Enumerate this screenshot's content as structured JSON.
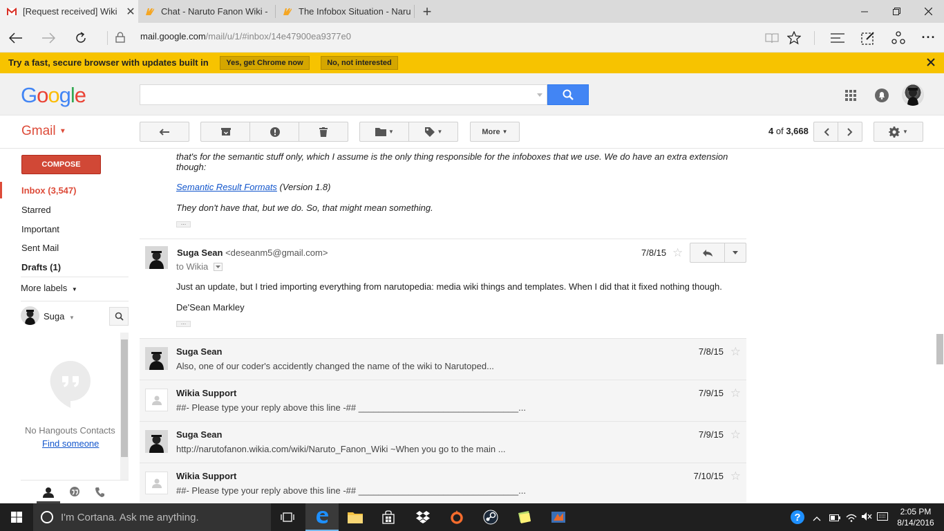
{
  "browser": {
    "tabs": [
      {
        "title": "[Request received] Wiki"
      },
      {
        "title": "Chat - Naruto Fanon Wiki -"
      },
      {
        "title": "The Infobox Situation - Naru"
      }
    ],
    "url_host": "mail.google.com",
    "url_path": "/mail/u/1/#inbox/14e47900ea9377e0"
  },
  "infobar": {
    "message": "Try a fast, secure browser with updates built in",
    "yes_label": "Yes, get Chrome now",
    "no_label": "No, not interested"
  },
  "header": {
    "logo": "Google"
  },
  "toolbar": {
    "app_label": "Gmail",
    "more_label": "More",
    "pagination_current": "4",
    "pagination_of": "of",
    "pagination_total": "3,668"
  },
  "sidebar": {
    "compose_label": "COMPOSE",
    "items": [
      {
        "label": "Inbox (3,547)"
      },
      {
        "label": "Starred"
      },
      {
        "label": "Important"
      },
      {
        "label": "Sent Mail"
      },
      {
        "label": "Drafts (1)"
      }
    ],
    "more_labels": "More labels",
    "hangouts_user": "Suga",
    "no_contacts": "No Hangouts Contacts",
    "find_someone": "Find someone"
  },
  "thread": {
    "prev_text_1": "that's for the semantic stuff only, which I assume is the only thing responsible for the infoboxes that we use. We do have an extra extension though:",
    "prev_link": "Semantic Result Formats",
    "prev_version": " (Version 1.8)",
    "prev_text_2": "They don't have that, but we do. So, that might mean something.",
    "expanded": {
      "from_name": "Suga Sean",
      "from_email": "<deseanm5@gmail.com>",
      "to": "to Wikia",
      "date": "7/8/15",
      "body": "Just an update, but I tried importing everything from narutopedia: media wiki things and templates. When I did that it fixed nothing though.",
      "signature": "De'Sean Markley"
    },
    "collapsed": [
      {
        "from": "Suga Sean",
        "snippet": "Also, one of our coder's accidently changed the name of the wiki to Narutoped...",
        "date": "7/8/15"
      },
      {
        "from": "Wikia Support",
        "snippet": "##- Please type your reply above this line -## ________________________________...",
        "date": "7/9/15"
      },
      {
        "from": "Suga Sean",
        "snippet": "http://narutofanon.wikia.com/wiki/Naruto_Fanon_Wiki ~When you go to the main ...",
        "date": "7/9/15"
      },
      {
        "from": "Wikia Support",
        "snippet": "##- Please type your reply above this line -## ________________________________...",
        "date": "7/10/15"
      }
    ]
  },
  "taskbar": {
    "cortana": "I'm Cortana. Ask me anything.",
    "time": "2:05 PM",
    "date": "8/14/2016"
  },
  "colors": {
    "gmail_red": "#dd4b39",
    "search_blue": "#4285f4",
    "infobar_yellow": "#f7c300",
    "link_blue": "#1155cc"
  }
}
